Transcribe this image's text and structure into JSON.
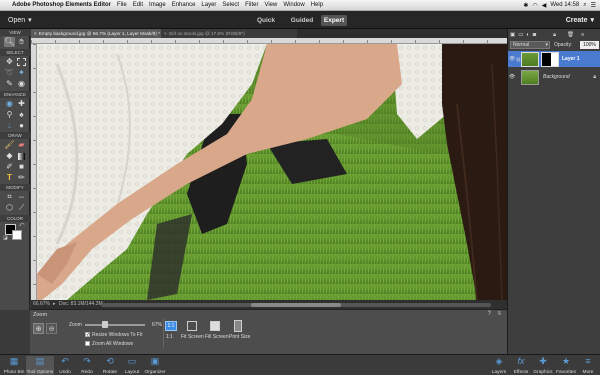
{
  "menubar": {
    "app_name": "Adobe Photoshop Elements Editor",
    "items": [
      "File",
      "Edit",
      "Image",
      "Enhance",
      "Layer",
      "Select",
      "Filter",
      "View",
      "Window",
      "Help"
    ],
    "clock": "Wed 14:58"
  },
  "modebar": {
    "open_label": "Open",
    "modes": [
      "Quick",
      "Guided",
      "Expert"
    ],
    "active_mode": "Expert",
    "create_label": "Create"
  },
  "toolbar": {
    "sections": [
      "VIEW",
      "SELECT",
      "ENHANCE",
      "DRAW",
      "MODIFY",
      "COLOR"
    ]
  },
  "tabs": [
    {
      "label": "Empty background.jpg @ 66.7% (Layer 1, Layer Mask/8) *"
    },
    {
      "label": "Girl on stools.jpg @ 17.6% (RGB/8*)"
    }
  ],
  "status": {
    "zoom": "66.67%",
    "doc": "Doc: 83.1M/144.3M"
  },
  "options": {
    "tool_name": "Zoom",
    "zoom_label": "Zoom",
    "zoom_value": "67%",
    "zoom_fraction": 0.33,
    "resize_label": "Resize Windows To Fit",
    "resize_checked": true,
    "zoom_all_label": "Zoom All Windows",
    "zoom_all_checked": false,
    "view_buttons": [
      "1:1",
      "Fit Screen",
      "Fill Screen",
      "Print Size"
    ]
  },
  "bottombar": {
    "left": [
      "Photo Bin",
      "Tool Options",
      "Undo",
      "Redo",
      "Rotate",
      "Layout",
      "Organizer"
    ],
    "right": [
      "Layers",
      "Effects",
      "Graphics",
      "Favorites",
      "More"
    ]
  },
  "layers": {
    "blend_mode": "Normal",
    "opacity_label": "Opacity:",
    "opacity_value": "100%",
    "items": [
      {
        "name": "Layer 1",
        "selected": true
      },
      {
        "name": "Background",
        "selected": false
      }
    ]
  }
}
